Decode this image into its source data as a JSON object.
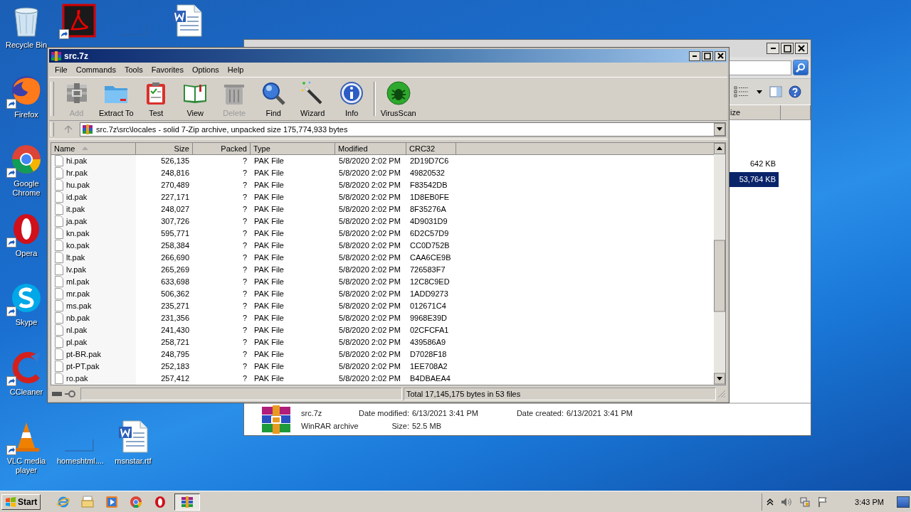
{
  "desktop_icons": [
    {
      "label": "Recycle Bin",
      "kind": "recycle",
      "shortcut": false
    },
    {
      "kind": "pdf",
      "shortcut": true
    },
    {
      "kind": "blank",
      "shortcut": false
    },
    {
      "kind": "word",
      "shortcut": false
    },
    {
      "label": "Firefox",
      "kind": "firefox",
      "shortcut": true
    },
    {
      "label": "Google Chrome",
      "kind": "chrome",
      "shortcut": true
    },
    {
      "label": "Opera",
      "kind": "opera",
      "shortcut": true
    },
    {
      "label": "Skype",
      "kind": "skype",
      "shortcut": true
    },
    {
      "label": "CCleaner",
      "kind": "ccleaner",
      "shortcut": true
    },
    {
      "label": "VLC media player",
      "kind": "vlc",
      "shortcut": true
    },
    {
      "label": "homeshtml....",
      "kind": "blank",
      "shortcut": false
    },
    {
      "label": "msnstar.rtf",
      "kind": "word",
      "shortcut": false
    }
  ],
  "explorer": {
    "column": "ize",
    "rows": [
      {
        "size": "642 KB",
        "selected": false
      },
      {
        "size": "53,764 KB",
        "selected": true
      }
    ],
    "details": {
      "name": "src.7z",
      "type": "WinRAR archive",
      "modified_label": "Date modified:",
      "modified": "6/13/2021 3:41 PM",
      "created_label": "Date created:",
      "created": "6/13/2021 3:41 PM",
      "size_label": "Size:",
      "size": "52.5 MB"
    }
  },
  "winrar": {
    "title": "src.7z",
    "menu": [
      "File",
      "Commands",
      "Tools",
      "Favorites",
      "Options",
      "Help"
    ],
    "toolbar": [
      {
        "label": "Add",
        "kind": "add",
        "disabled": true
      },
      {
        "label": "Extract To",
        "kind": "extract",
        "disabled": false
      },
      {
        "label": "Test",
        "kind": "test",
        "disabled": false
      },
      {
        "label": "View",
        "kind": "view",
        "disabled": false
      },
      {
        "label": "Delete",
        "kind": "delete",
        "disabled": true
      },
      {
        "label": "Find",
        "kind": "find",
        "disabled": false
      },
      {
        "label": "Wizard",
        "kind": "wizard",
        "disabled": false
      },
      {
        "label": "Info",
        "kind": "info",
        "disabled": false
      },
      {
        "label": "VirusScan",
        "kind": "virus",
        "disabled": false,
        "separated": true
      }
    ],
    "address": "src.7z\\src\\locales - solid 7-Zip archive, unpacked size 175,774,933 bytes",
    "columns": [
      {
        "label": "Name",
        "sorted": true
      },
      {
        "label": "Size",
        "sorted": false
      },
      {
        "label": "Packed",
        "sorted": false
      },
      {
        "label": "Type",
        "sorted": false
      },
      {
        "label": "Modified",
        "sorted": false
      },
      {
        "label": "CRC32",
        "sorted": false
      }
    ],
    "rows": [
      [
        "hi.pak",
        "526,135",
        "?",
        "PAK File",
        "5/8/2020 2:02 PM",
        "2D19D7C6"
      ],
      [
        "hr.pak",
        "248,816",
        "?",
        "PAK File",
        "5/8/2020 2:02 PM",
        "49820532"
      ],
      [
        "hu.pak",
        "270,489",
        "?",
        "PAK File",
        "5/8/2020 2:02 PM",
        "F83542DB"
      ],
      [
        "id.pak",
        "227,171",
        "?",
        "PAK File",
        "5/8/2020 2:02 PM",
        "1D8EB0FE"
      ],
      [
        "it.pak",
        "248,027",
        "?",
        "PAK File",
        "5/8/2020 2:02 PM",
        "8F35276A"
      ],
      [
        "ja.pak",
        "307,726",
        "?",
        "PAK File",
        "5/8/2020 2:02 PM",
        "4D9031D9"
      ],
      [
        "kn.pak",
        "595,771",
        "?",
        "PAK File",
        "5/8/2020 2:02 PM",
        "6D2C57D9"
      ],
      [
        "ko.pak",
        "258,384",
        "?",
        "PAK File",
        "5/8/2020 2:02 PM",
        "CC0D752B"
      ],
      [
        "lt.pak",
        "266,690",
        "?",
        "PAK File",
        "5/8/2020 2:02 PM",
        "CAA6CE9B"
      ],
      [
        "lv.pak",
        "265,269",
        "?",
        "PAK File",
        "5/8/2020 2:02 PM",
        "726583F7"
      ],
      [
        "ml.pak",
        "633,698",
        "?",
        "PAK File",
        "5/8/2020 2:02 PM",
        "12C8C9ED"
      ],
      [
        "mr.pak",
        "506,362",
        "?",
        "PAK File",
        "5/8/2020 2:02 PM",
        "1ADD9273"
      ],
      [
        "ms.pak",
        "235,271",
        "?",
        "PAK File",
        "5/8/2020 2:02 PM",
        "012671C4"
      ],
      [
        "nb.pak",
        "231,356",
        "?",
        "PAK File",
        "5/8/2020 2:02 PM",
        "9968E39D"
      ],
      [
        "nl.pak",
        "241,430",
        "?",
        "PAK File",
        "5/8/2020 2:02 PM",
        "02CFCFA1"
      ],
      [
        "pl.pak",
        "258,721",
        "?",
        "PAK File",
        "5/8/2020 2:02 PM",
        "439586A9"
      ],
      [
        "pt-BR.pak",
        "248,795",
        "?",
        "PAK File",
        "5/8/2020 2:02 PM",
        "D7028F18"
      ],
      [
        "pt-PT.pak",
        "252,183",
        "?",
        "PAK File",
        "5/8/2020 2:02 PM",
        "1EE708A2"
      ],
      [
        "ro.pak",
        "257,412",
        "?",
        "PAK File",
        "5/8/2020 2:02 PM",
        "B4DBAEA4"
      ]
    ],
    "status": "Total 17,145,175 bytes in 53 files"
  },
  "taskbar": {
    "start": "Start",
    "apps": [
      {
        "kind": "ie",
        "selected": false
      },
      {
        "kind": "explorer",
        "selected": false
      },
      {
        "kind": "media",
        "selected": false
      },
      {
        "kind": "chrome",
        "selected": false
      },
      {
        "kind": "opera",
        "selected": false
      },
      {
        "kind": "winrar",
        "selected": true
      }
    ],
    "clock": "3:43 PM"
  }
}
